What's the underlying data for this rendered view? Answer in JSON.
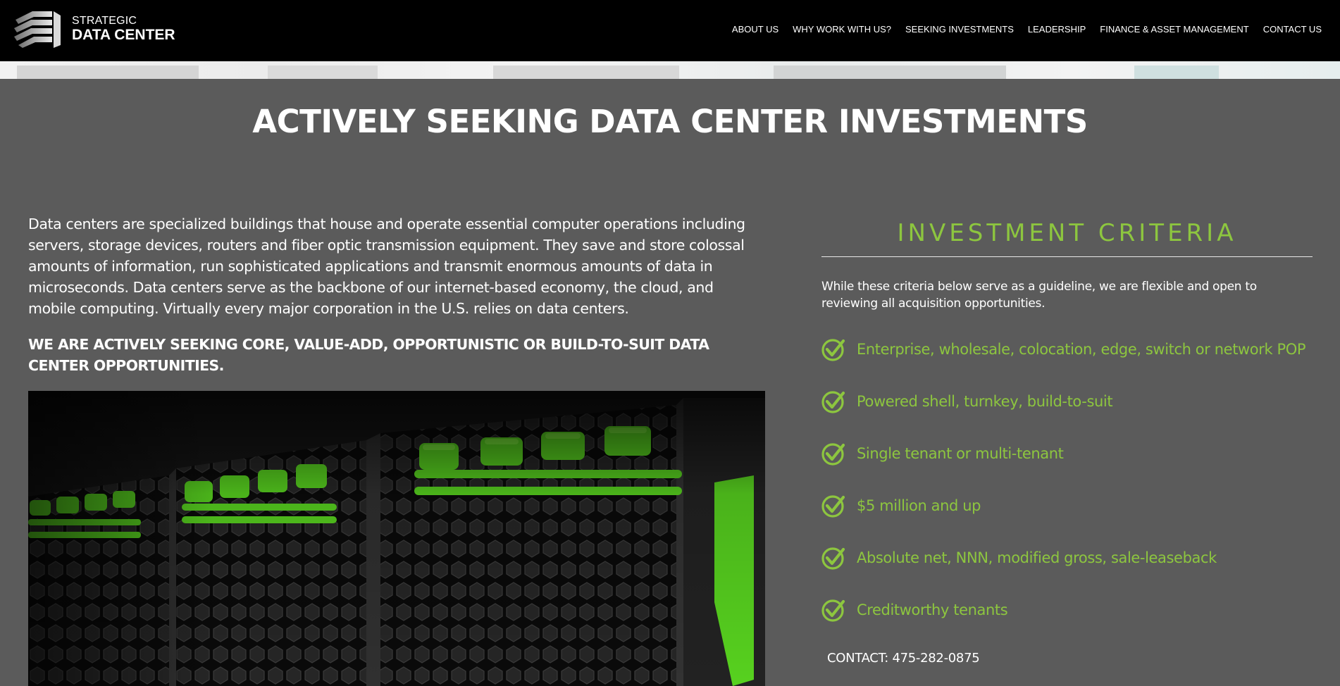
{
  "header": {
    "logo_line1": "STRATEGIC",
    "logo_line2": "DATA CENTER",
    "nav": [
      {
        "label": "ABOUT US"
      },
      {
        "label": "WHY WORK WITH US?"
      },
      {
        "label": "SEEKING INVESTMENTS"
      },
      {
        "label": "LEADERSHIP"
      },
      {
        "label": "FINANCE & ASSET MANAGEMENT"
      },
      {
        "label": "CONTACT US"
      }
    ]
  },
  "main": {
    "title": "ACTIVELY SEEKING DATA CENTER INVESTMENTS",
    "intro": "Data centers are specialized buildings that house and operate essential computer operations including servers, storage devices, routers and fiber optic transmission equipment. They save and store colossal amounts of information, run sophisticated applications and transmit enormous amounts of data in microseconds. Data centers serve as the backbone of our internet-based economy, the cloud, and mobile computing. Virtually every major corporation in the U.S. relies on data centers.",
    "seeking": "WE ARE ACTIVELY SEEKING CORE, VALUE-ADD, OPPORTUNISTIC OR BUILD-TO-SUIT DATA CENTER OPPORTUNITIES."
  },
  "criteria": {
    "title": "INVESTMENT CRITERIA",
    "intro": "While these criteria below serve as a guideline, we are flexible and open to reviewing all acquisition opportunities.",
    "items": [
      {
        "text": "Enterprise, wholesale, colocation, edge, switch or network POP"
      },
      {
        "text": "Powered shell, turnkey, build-to-suit"
      },
      {
        "text": "Single tenant or multi-tenant"
      },
      {
        "text": "$5 million and up"
      },
      {
        "text": "Absolute net, NNN, modified gross, sale-leaseback"
      },
      {
        "text": "Creditworthy tenants"
      }
    ],
    "contact_label": "CONTACT:",
    "contact_phone": "475-282-0875"
  },
  "colors": {
    "header_bg": "#000000",
    "page_bg": "#5b5b5b",
    "accent_green": "#8dc63f",
    "text": "#ffffff"
  },
  "icons": {
    "logo": "stacked-chevron-logo-icon",
    "criteria_bullet": "check-circle-icon"
  }
}
